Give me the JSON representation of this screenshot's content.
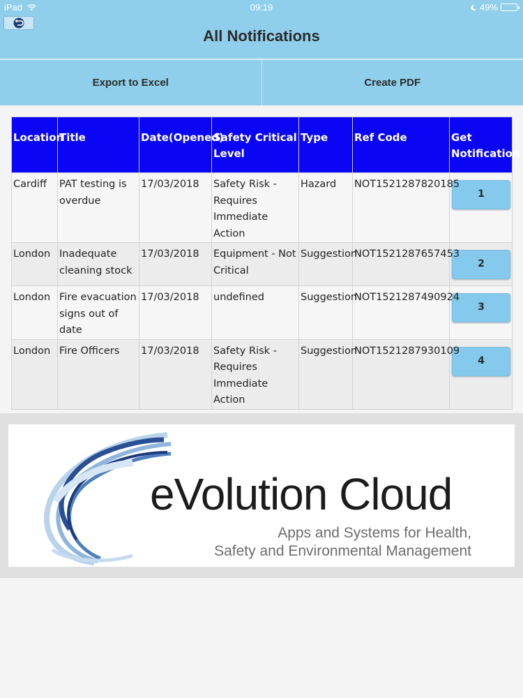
{
  "status_bar": {
    "device": "iPad",
    "time": "09:19",
    "battery": "49%",
    "battery_level": 0.49
  },
  "header": {
    "title": "All Notifications",
    "back_icon": "undo-arrow-icon"
  },
  "actions": {
    "export_label": "Export to Excel",
    "pdf_label": "Create PDF"
  },
  "table": {
    "columns": [
      "Location",
      "Title",
      "Date(Opened)",
      "Safety Critical Level",
      "Type",
      "Ref Code",
      "Get Notification"
    ],
    "rows": [
      {
        "location": "Cardiff",
        "title": "PAT testing is overdue",
        "date": "17/03/2018",
        "level": "Safety Risk - Requires Immediate Action",
        "type": "Hazard",
        "ref": "NOT1521287820185",
        "button": "1"
      },
      {
        "location": "London",
        "title": "Inadequate cleaning stock",
        "date": "17/03/2018",
        "level": "Equipment - Not Critical",
        "type": "Suggestion",
        "ref": "NOT1521287657453",
        "button": "2"
      },
      {
        "location": "London",
        "title": "Fire evacuation signs out of date",
        "date": "17/03/2018",
        "level": "undefined",
        "type": "Suggestion",
        "ref": "NOT1521287490924",
        "button": "3"
      },
      {
        "location": "London",
        "title": "Fire Officers",
        "date": "17/03/2018",
        "level": "Safety Risk - Requires Immediate Action",
        "type": "Suggestion",
        "ref": "NOT1521287930109",
        "button": "4"
      }
    ]
  },
  "logo": {
    "name": "eVolution Cloud",
    "tagline_1": "Apps and Systems for Health,",
    "tagline_2": "Safety and Environmental Management",
    "icon": "swirl-logo-icon"
  },
  "colors": {
    "header_bg": "#8fcfeb",
    "table_header_bg": "#0a06f5",
    "button_bg": "#85c9ec"
  }
}
